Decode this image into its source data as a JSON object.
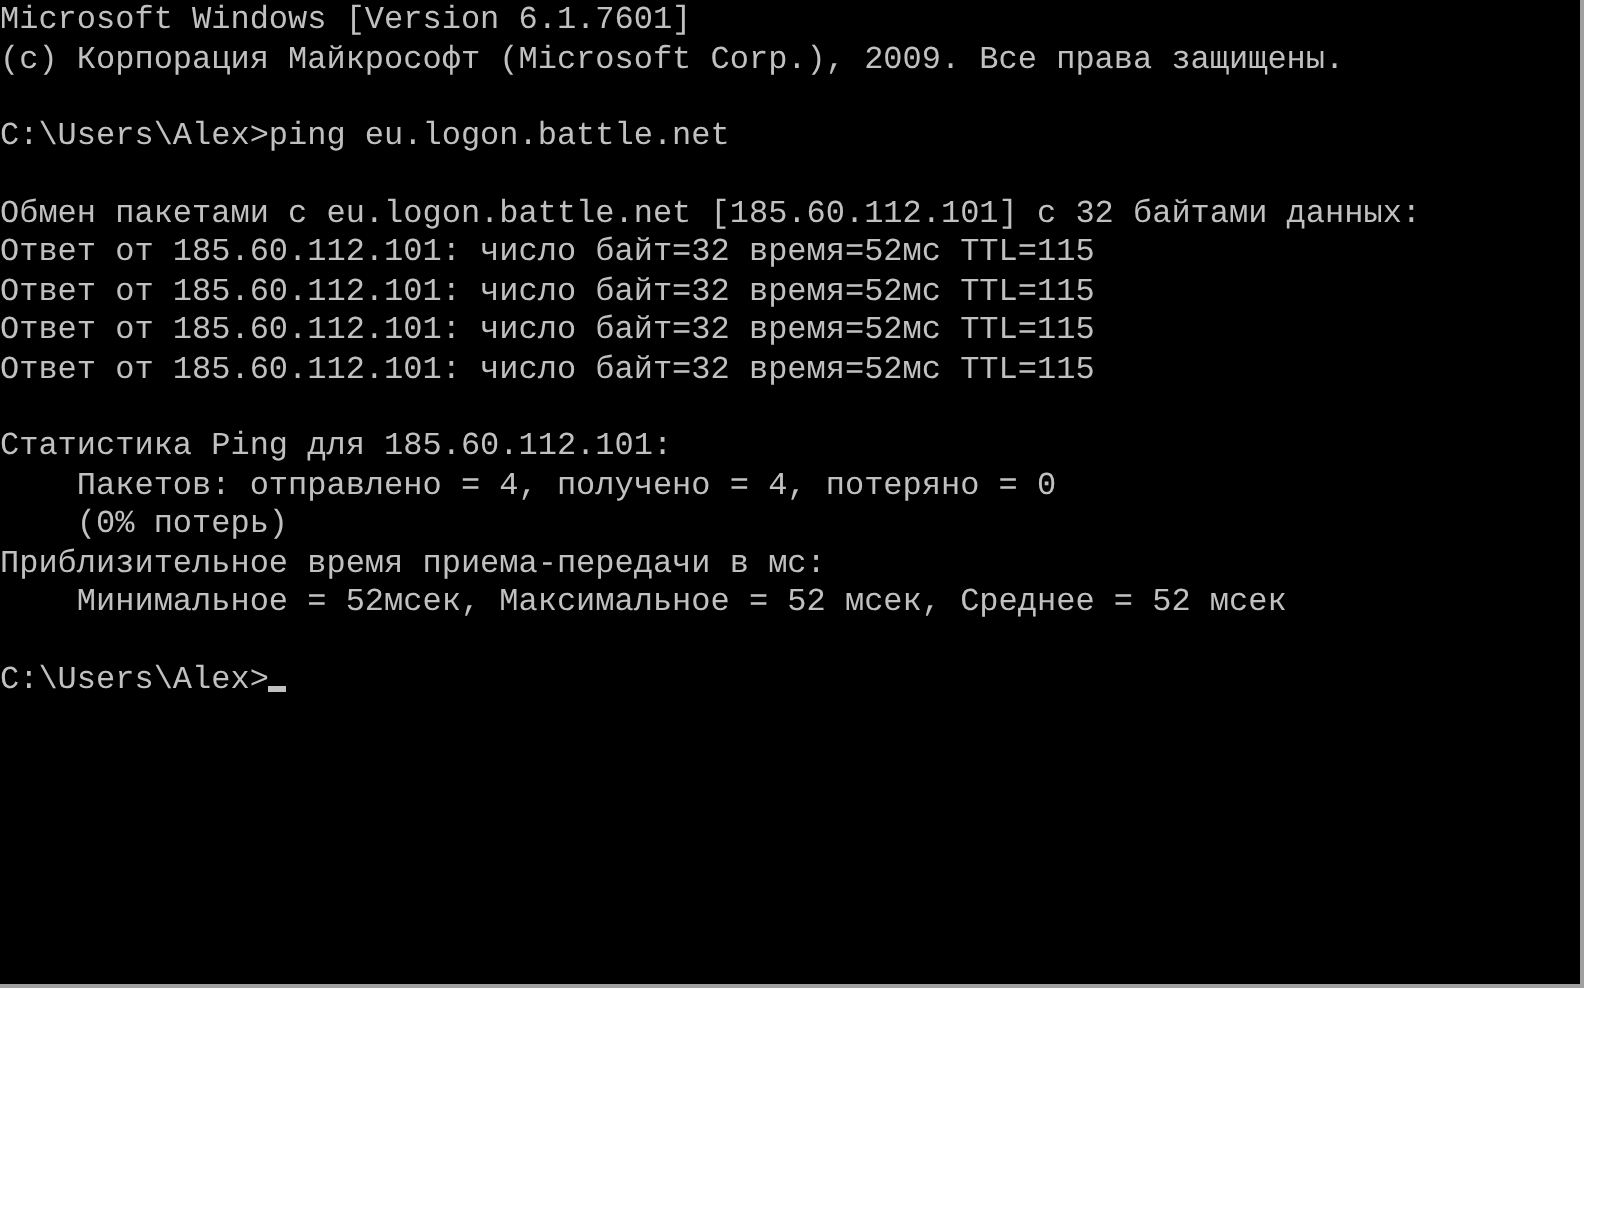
{
  "console": {
    "blocks": [
      {
        "lines": [
          "Microsoft Windows [Version 6.1.7601]",
          "(c) Корпорация Майкрософт (Microsoft Corp.), 2009. Все права защищены."
        ]
      },
      {
        "lines": [
          "C:\\Users\\Alex>ping eu.logon.battle.net"
        ]
      },
      {
        "lines": [
          "Обмен пакетами с eu.logon.battle.net [185.60.112.101] с 32 байтами данных:",
          "Ответ от 185.60.112.101: число байт=32 время=52мс TTL=115",
          "Ответ от 185.60.112.101: число байт=32 время=52мс TTL=115",
          "Ответ от 185.60.112.101: число байт=32 время=52мс TTL=115",
          "Ответ от 185.60.112.101: число байт=32 время=52мс TTL=115"
        ]
      },
      {
        "lines": [
          "Статистика Ping для 185.60.112.101:",
          "    Пакетов: отправлено = 4, получено = 4, потеряно = 0",
          "    (0% потерь)",
          "Приблизительное время приема-передачи в мс:",
          "    Минимальное = 52мсек, Максимальное = 52 мсек, Среднее = 52 мсек"
        ]
      },
      {
        "lines": [
          "C:\\Users\\Alex>"
        ],
        "cursor": true
      }
    ]
  }
}
